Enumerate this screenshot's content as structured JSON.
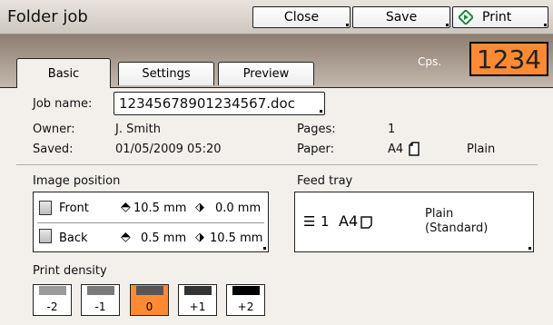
{
  "app": {
    "title": "Folder job"
  },
  "toolbar": {
    "close_label": "Close",
    "save_label": "Save",
    "print_label": "Print"
  },
  "tabs": [
    {
      "label": "Basic",
      "active": true
    },
    {
      "label": "Settings",
      "active": false
    },
    {
      "label": "Preview",
      "active": false
    }
  ],
  "counter": {
    "label": "Cps.",
    "value": "1234",
    "color": "#ff8a33"
  },
  "job": {
    "name_label": "Job name:",
    "name_value": "12345678901234567.doc",
    "owner_label": "Owner:",
    "owner_value": "J. Smith",
    "saved_label": "Saved:",
    "saved_value": "01/05/2009 05:20",
    "pages_label": "Pages:",
    "pages_value": "1",
    "paper_label": "Paper:",
    "paper_size": "A4",
    "paper_type": "Plain"
  },
  "image_position": {
    "heading": "Image position",
    "front": {
      "label": "Front",
      "vertical": "10.5 mm",
      "horizontal": "0.0 mm"
    },
    "back": {
      "label": "Back",
      "vertical": "0.5 mm",
      "horizontal": "10.5 mm"
    }
  },
  "feed_tray": {
    "heading": "Feed tray",
    "tray": "1",
    "size": "A4",
    "type_line1": "Plain",
    "type_line2": "(Standard)"
  },
  "print_density": {
    "heading": "Print density",
    "options": [
      {
        "label": "-2",
        "shade": "#9a9a9a"
      },
      {
        "label": "-1",
        "shade": "#7a7a7a"
      },
      {
        "label": "0",
        "shade": "#555555"
      },
      {
        "label": "+1",
        "shade": "#333333"
      },
      {
        "label": "+2",
        "shade": "#000000"
      }
    ],
    "selected": "0",
    "selected_color": "#ff8a33"
  }
}
